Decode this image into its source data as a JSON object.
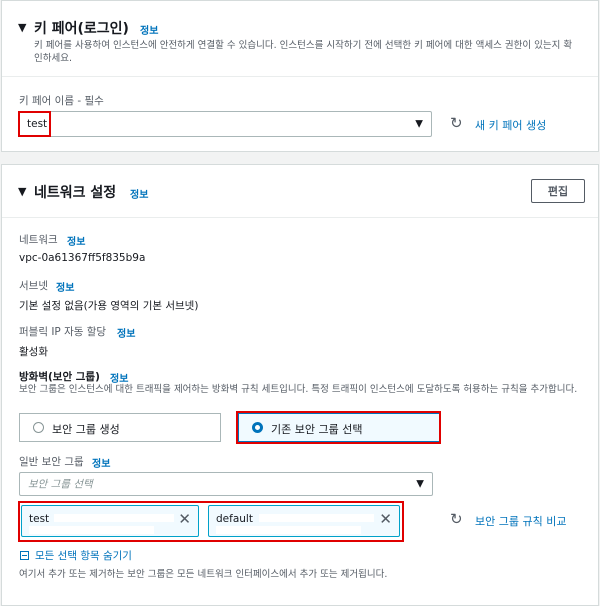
{
  "key_pair": {
    "title": "키 페어(로그인)",
    "info": "정보",
    "description": "키 페어를 사용하여 인스턴스에 안전하게 연결할 수 있습니다. 인스턴스를 시작하기 전에 선택한 키 페어에 대한 액세스 권한이 있는지 확인하세요.",
    "name_label": "키 페어 이름 - 필수",
    "name_value": "test",
    "create_link": "새 키 페어 생성"
  },
  "network": {
    "title": "네트워크 설정",
    "info": "정보",
    "edit_button": "편집",
    "network_label": "네트워크",
    "network_info": "정보",
    "network_value": "vpc-0a61367ff5f835b9a",
    "subnet_label": "서브넷",
    "subnet_info": "정보",
    "subnet_value": "기본 설정 없음(가용 영역의 기본 서브넷)",
    "public_ip_label": "퍼블릭 IP 자동 할당",
    "public_ip_info": "정보",
    "public_ip_value": "활성화",
    "firewall_label": "방화벽(보안 그룹)",
    "firewall_info": "정보",
    "firewall_desc": "보안 그룹은 인스턴스에 대한 트래픽을 제어하는 방화벽 규칙 세트입니다. 특정 트래픽이 인스턴스에 도달하도록 허용하는 규칙을 추가합니다.",
    "radio_create": "보안 그룹 생성",
    "radio_existing": "기존 보안 그룹 선택",
    "sg_label": "일반 보안 그룹",
    "sg_info": "정보",
    "sg_placeholder": "보안 그룹 선택",
    "tokens": [
      "test",
      "default"
    ],
    "compare_link": "보안 그룹 규칙 비교",
    "hide_link": "모든 선택 항목 숨기기",
    "footer_note": "여기서 추가 또는 제거하는 보안 그룹은 모든 네트워크 인터페이스에서 추가 또는 제거됩니다."
  }
}
